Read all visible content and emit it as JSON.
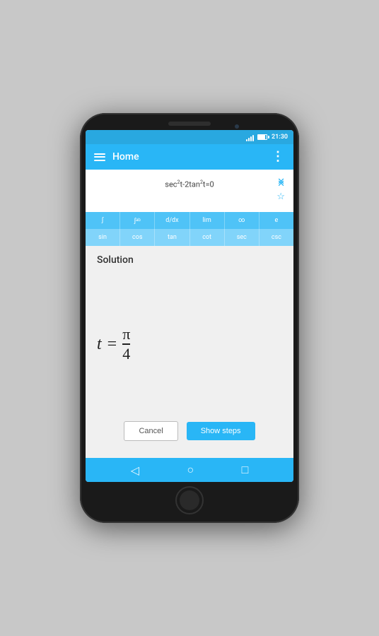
{
  "status_bar": {
    "time": "21:30"
  },
  "app_bar": {
    "title": "Home",
    "more_icon": "⋮"
  },
  "equation": {
    "text": "sec²t-2tan²t=0",
    "display_html": "sec<sup>2</sup>t-2tan<sup>2</sup>t=0"
  },
  "keyboard": {
    "row1": [
      "∫",
      "∫ᵃᵇ",
      "d/dx",
      "lim",
      "∞",
      "e"
    ],
    "row2": [
      "sin",
      "cos",
      "tan",
      "cot",
      "sec",
      "csc"
    ]
  },
  "solution": {
    "label": "Solution",
    "variable": "t",
    "equals": "=",
    "numerator": "π",
    "denominator": "4"
  },
  "buttons": {
    "cancel": "Cancel",
    "show_steps": "Show steps"
  },
  "nav": {
    "back": "◁",
    "home": "○",
    "recent": "□"
  },
  "icons": {
    "clear_all": "✕",
    "clear_equation": "✕",
    "star": "☆"
  }
}
